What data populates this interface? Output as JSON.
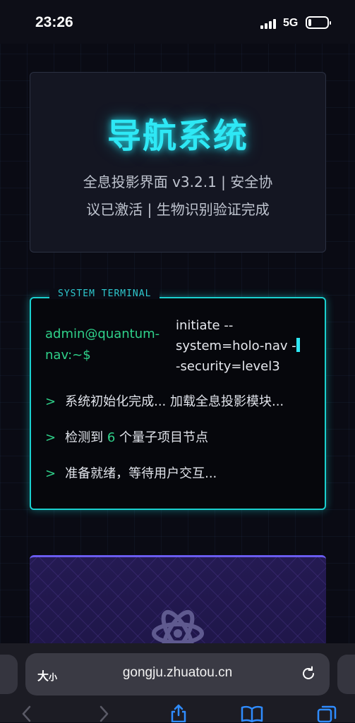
{
  "status_bar": {
    "time": "23:26",
    "network": "5G",
    "battery_percent": 10
  },
  "header": {
    "title": "导航系统",
    "subtitle_line1": "全息投影界面 v3.2.1 | 安全协",
    "subtitle_line2": "议已激活 | 生物识别验证完成"
  },
  "terminal": {
    "label": "SYSTEM TERMINAL",
    "prompt_line1": "admin@quantum-",
    "prompt_line2": "nav:~$",
    "command_line1": "initiate --",
    "command_line2": "system=holo-nav -",
    "command_line3": "-security=level3",
    "prefix": ">",
    "output1": "系统初始化完成... 加载全息投影模块...",
    "output2_before": "检测到",
    "output2_count": "6",
    "output2_after": "个量子项目节点",
    "output3": "准备就绪，等待用户交互..."
  },
  "project_card": {
    "icon": "atom-icon"
  },
  "browser": {
    "text_size_label_big": "大",
    "text_size_label_small": "小",
    "url": "gongju.zhuatou.cn",
    "icons": [
      "reload-icon",
      "back-icon",
      "forward-icon",
      "share-icon",
      "bookmarks-icon",
      "tabs-icon"
    ]
  },
  "colors": {
    "accent_cyan": "#2ee8f5",
    "prompt_green": "#2fd18a",
    "background": "#0a0b14"
  }
}
